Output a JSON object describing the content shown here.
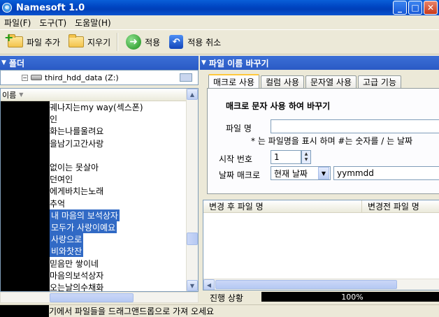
{
  "window": {
    "title": "Namesoft 1.0",
    "minimize": "_",
    "maximize": "□",
    "close": "✕"
  },
  "menu": [
    "파일(F)",
    "도구(T)",
    "도움말(H)"
  ],
  "toolbar": {
    "add_file": "파일 추가",
    "delete": "지우기",
    "apply": "적용",
    "cancel_apply": "적용 취소"
  },
  "left_panel": {
    "title": "폴더",
    "drive": "third_hdd_data (Z:)",
    "column": "이름",
    "files": [
      {
        "name": "궤나지는my way(섹스폰)",
        "selected": false
      },
      {
        "name": "인",
        "selected": false
      },
      {
        "name": "화는나를울려요",
        "selected": false
      },
      {
        "name": "을남기고간사랑",
        "selected": false
      },
      {
        "name": "",
        "selected": false
      },
      {
        "name": "없이는 못살아",
        "selected": false
      },
      {
        "name": "던여인",
        "selected": false
      },
      {
        "name": "에게바치는노래",
        "selected": false
      },
      {
        "name": "추억",
        "selected": false
      },
      {
        "name": "내 마음의 보석상자",
        "selected": true
      },
      {
        "name": "모두가 사랑이예요",
        "selected": true
      },
      {
        "name": "사랑으로",
        "selected": true
      },
      {
        "name": "비와찻잔",
        "selected": true
      },
      {
        "name": "믿음만 쌓이네",
        "selected": false
      },
      {
        "name": "마음의보석상자",
        "selected": false
      },
      {
        "name": "오는날의수채화",
        "selected": false
      }
    ]
  },
  "right_panel": {
    "title": "파일 이름 바꾸기",
    "tabs": [
      "매크로 사용",
      "컬럼 사용",
      "문자열 사용",
      "고급 기능"
    ],
    "active_tab": 0,
    "section_title": "매크로 문자 사용 하여 바꾸기",
    "file_name_label": "파일 명",
    "file_name_value": "",
    "hint": "* 는 파일명을 표시 하며 #는 숫자를 / 는 날짜",
    "start_number_label": "시작 번호",
    "start_number": "1",
    "date_macro_label": "날짜 매크로",
    "date_macro_option": "현재 날짜",
    "date_format": "yymmdd",
    "grid_columns": [
      "변경 후 파일 명",
      "변경전 파일 명"
    ],
    "progress_label": "진행 상황",
    "progress": "100%"
  },
  "status": "기에서 파일들을 드래그앤드롭으로 가져 오세요"
}
